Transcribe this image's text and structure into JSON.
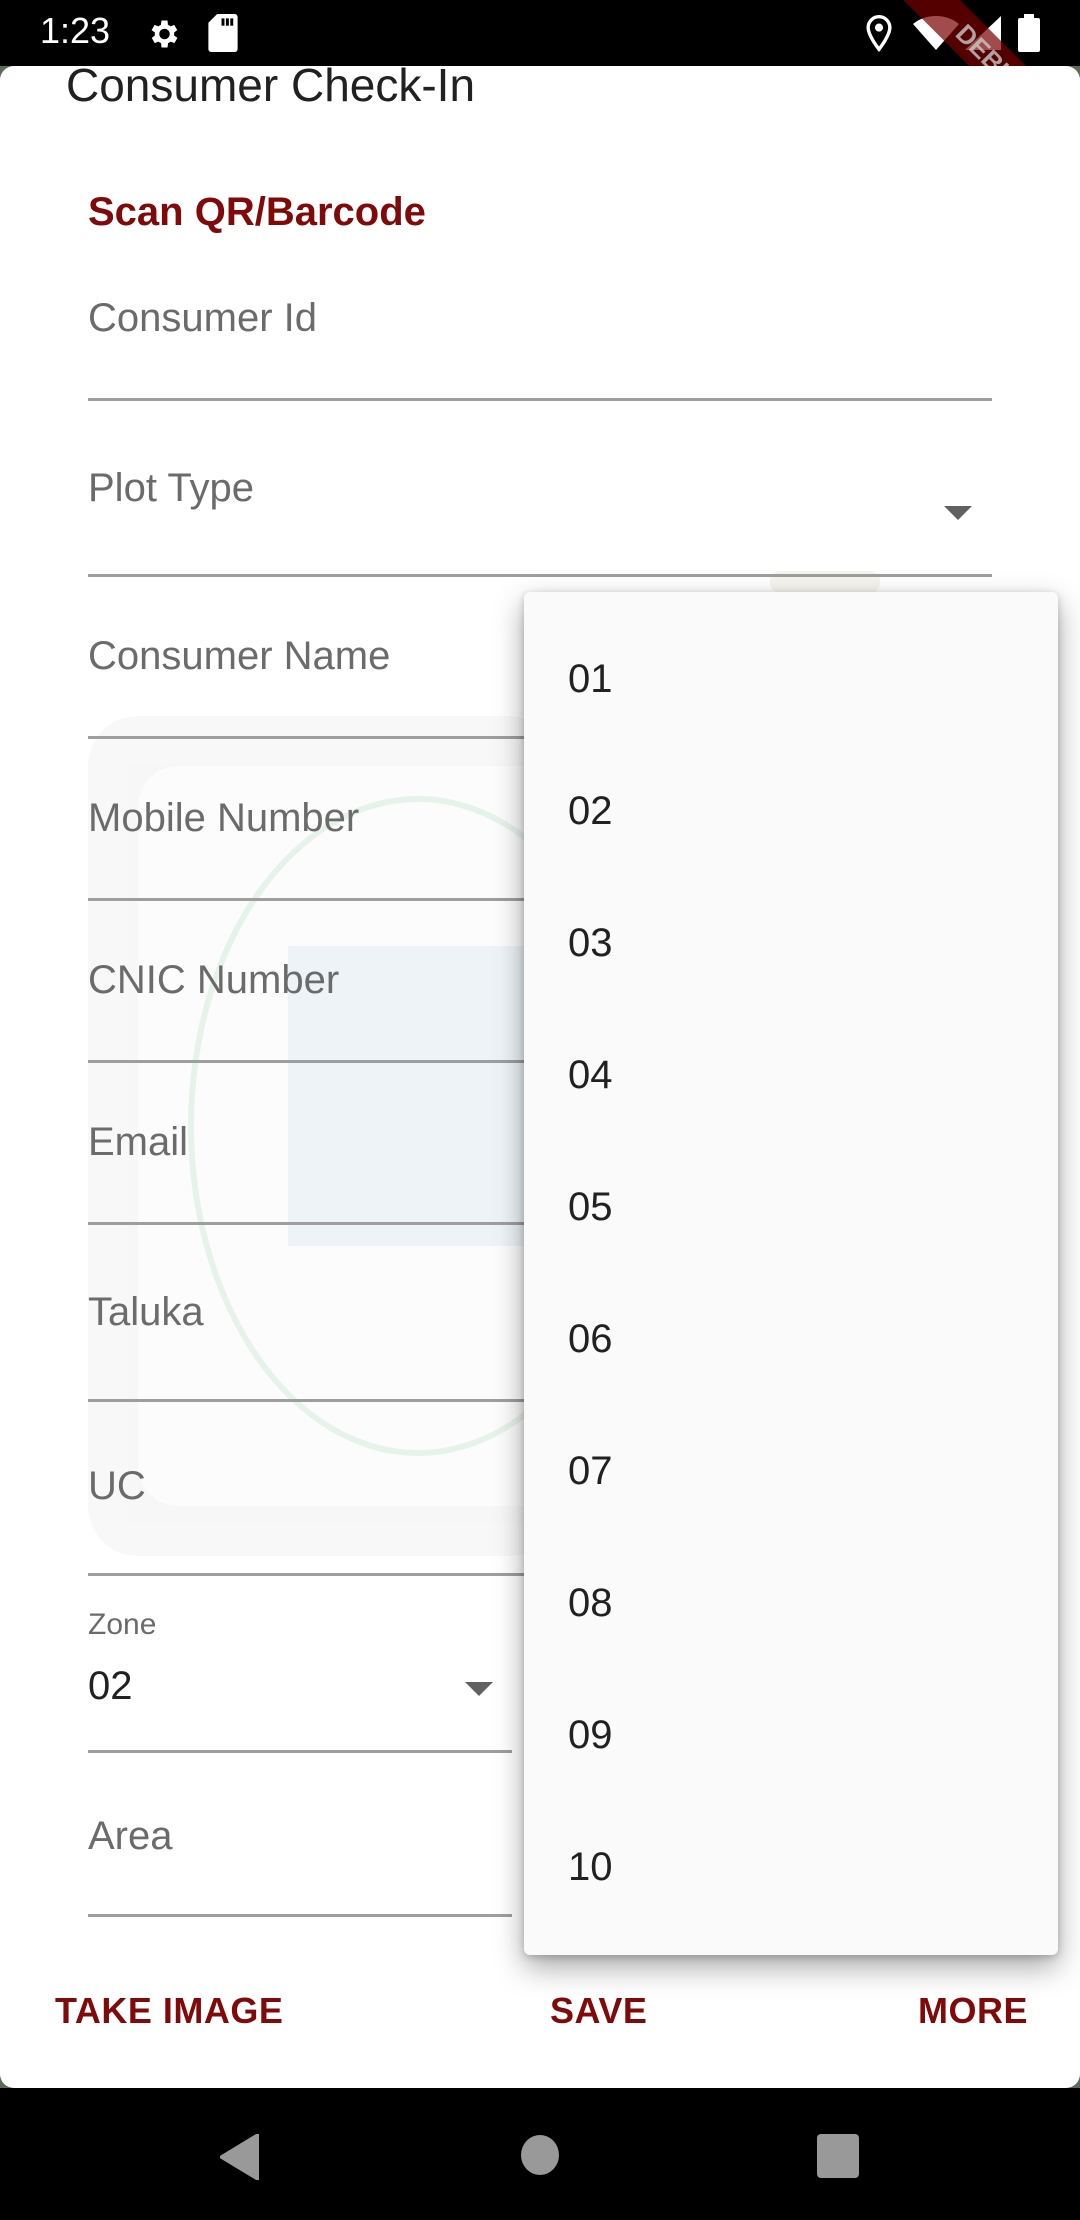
{
  "status_bar": {
    "time": "1:23",
    "left_icons": [
      "gear-icon",
      "sd-card-icon"
    ],
    "right_icons": [
      "location-icon",
      "wifi-icon",
      "signal-icon",
      "battery-icon"
    ],
    "debug_banner": "DEBUG"
  },
  "dialog": {
    "title": "Consumer Check-In",
    "scan_link": "Scan QR/Barcode",
    "fields": [
      {
        "label": "Consumer Id",
        "value": ""
      },
      {
        "label": "Plot Type",
        "value": "",
        "type": "dropdown"
      },
      {
        "label": "Consumer Name",
        "value": ""
      },
      {
        "label": "Mobile Number",
        "value": ""
      },
      {
        "label": "CNIC Number",
        "value": ""
      },
      {
        "label": "Email",
        "value": ""
      },
      {
        "label": "Taluka",
        "value": ""
      },
      {
        "label": "UC",
        "value": ""
      },
      {
        "label": "Zone",
        "value": "02",
        "type": "dropdown"
      },
      {
        "label": "Area",
        "value": ""
      }
    ],
    "actions": {
      "take_image": "TAKE IMAGE",
      "save": "SAVE",
      "more": "MORE"
    }
  },
  "dropdown_menu": {
    "options": [
      "01",
      "02",
      "03",
      "04",
      "05",
      "06",
      "07",
      "08",
      "09",
      "10"
    ]
  },
  "nav_bar": {
    "icons": [
      "back-icon",
      "home-icon",
      "recents-icon"
    ]
  },
  "colors": {
    "accent": "#800a0a",
    "label": "#6b6b6b",
    "text": "#212121",
    "underline": "#9e9e9e",
    "menu_bg": "#fafafa"
  }
}
